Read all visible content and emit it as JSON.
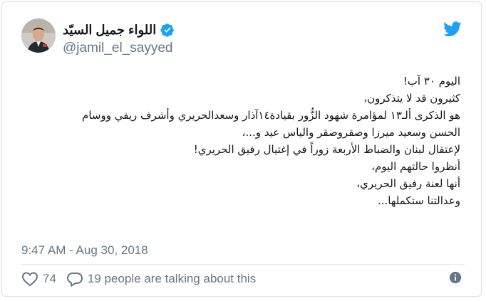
{
  "tweet": {
    "display_name": "اللواء جميل السيّد",
    "handle": "@jamil_el_sayyed",
    "lines": [
      "اليوم ٣٠ آب!",
      "كثيرون قد لا يتذكرون،",
      "هو الذكرى ألـ١٣ لمؤامرة شهود الزُّور بقيادة١٤آذار وسعدالحريري وأشرف ريفي ووسام",
      "الحسن وسعيد ميرزا وصقروصقر والياس عيد و...،",
      "لإعتقال لبنان والضباط الأربعة زوراً في إغتيال رفيق الحريري!",
      "أنظروا حالتهم اليوم،",
      "أنها لعنة رفيق الحريري،",
      "وعدالتنا ستكملها..."
    ],
    "timestamp": "9:47 AM - Aug 30, 2018",
    "like_count": "74",
    "talking_text": "19 people are talking about this"
  },
  "icons": {
    "logo": "twitter-bird-icon",
    "verified": "verified-badge-icon",
    "like": "heart-icon",
    "reply": "speech-bubble-icon",
    "info": "info-icon"
  },
  "colors": {
    "brand_blue": "#1da1f2",
    "secondary_text": "#657786",
    "primary_text": "#14171a",
    "border": "#d8dee3"
  }
}
